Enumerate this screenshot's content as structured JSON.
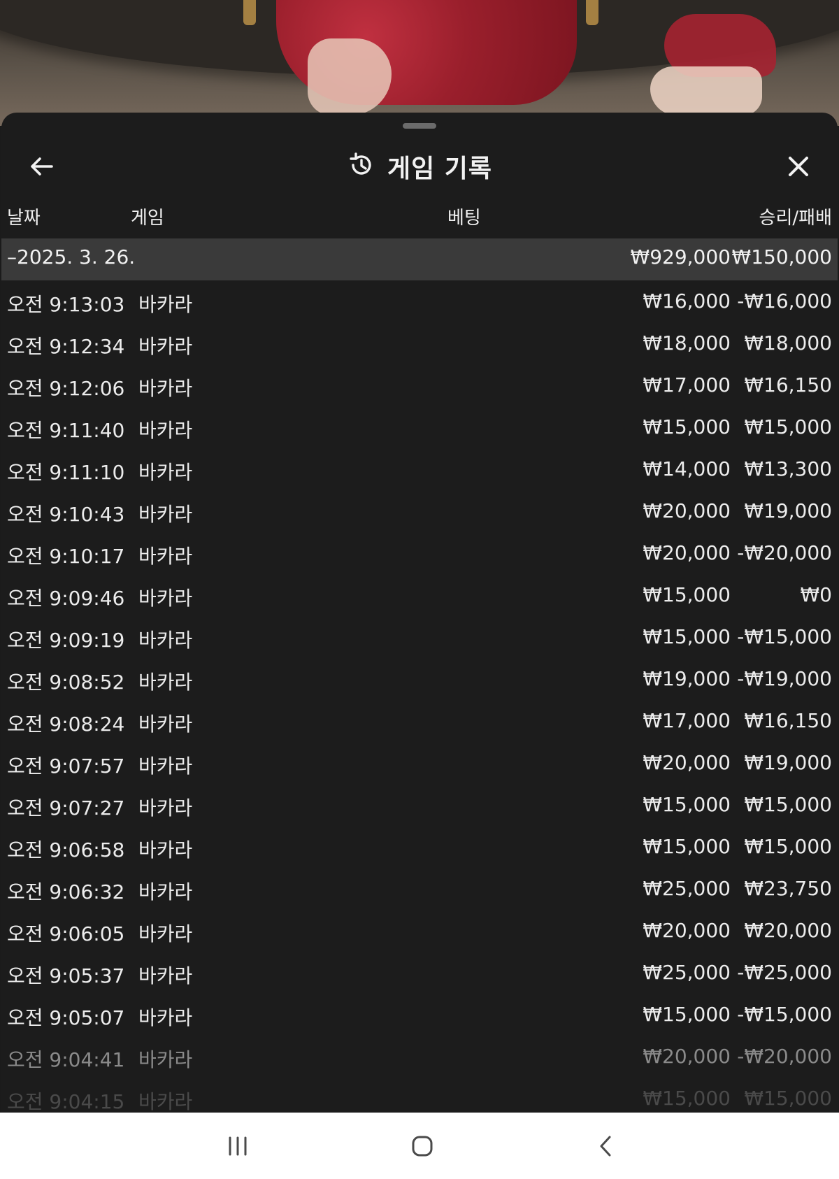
{
  "header": {
    "title": "게임 기록"
  },
  "columns": {
    "date": "날짜",
    "game": "게임",
    "bet": "베팅",
    "result": "승리/패배"
  },
  "summary": {
    "date": "–2025. 3. 26.",
    "bet_total": "₩929,000",
    "result_total": "₩150,000"
  },
  "rows": [
    {
      "time": "오전 9:13:03",
      "game": "바카라",
      "bet": "₩16,000",
      "result": "-₩16,000"
    },
    {
      "time": "오전 9:12:34",
      "game": "바카라",
      "bet": "₩18,000",
      "result": "₩18,000"
    },
    {
      "time": "오전 9:12:06",
      "game": "바카라",
      "bet": "₩17,000",
      "result": "₩16,150"
    },
    {
      "time": "오전 9:11:40",
      "game": "바카라",
      "bet": "₩15,000",
      "result": "₩15,000"
    },
    {
      "time": "오전 9:11:10",
      "game": "바카라",
      "bet": "₩14,000",
      "result": "₩13,300"
    },
    {
      "time": "오전 9:10:43",
      "game": "바카라",
      "bet": "₩20,000",
      "result": "₩19,000"
    },
    {
      "time": "오전 9:10:17",
      "game": "바카라",
      "bet": "₩20,000",
      "result": "-₩20,000"
    },
    {
      "time": "오전 9:09:46",
      "game": "바카라",
      "bet": "₩15,000",
      "result": "₩0"
    },
    {
      "time": "오전 9:09:19",
      "game": "바카라",
      "bet": "₩15,000",
      "result": "-₩15,000"
    },
    {
      "time": "오전 9:08:52",
      "game": "바카라",
      "bet": "₩19,000",
      "result": "-₩19,000"
    },
    {
      "time": "오전 9:08:24",
      "game": "바카라",
      "bet": "₩17,000",
      "result": "₩16,150"
    },
    {
      "time": "오전 9:07:57",
      "game": "바카라",
      "bet": "₩20,000",
      "result": "₩19,000"
    },
    {
      "time": "오전 9:07:27",
      "game": "바카라",
      "bet": "₩15,000",
      "result": "₩15,000"
    },
    {
      "time": "오전 9:06:58",
      "game": "바카라",
      "bet": "₩15,000",
      "result": "₩15,000"
    },
    {
      "time": "오전 9:06:32",
      "game": "바카라",
      "bet": "₩25,000",
      "result": "₩23,750"
    },
    {
      "time": "오전 9:06:05",
      "game": "바카라",
      "bet": "₩20,000",
      "result": "₩20,000"
    },
    {
      "time": "오전 9:05:37",
      "game": "바카라",
      "bet": "₩25,000",
      "result": "-₩25,000"
    },
    {
      "time": "오전 9:05:07",
      "game": "바카라",
      "bet": "₩15,000",
      "result": "-₩15,000"
    },
    {
      "time": "오전 9:04:41",
      "game": "바카라",
      "bet": "₩20,000",
      "result": "-₩20,000"
    },
    {
      "time": "오전 9:04:15",
      "game": "바카라",
      "bet": "₩15,000",
      "result": "₩15,000"
    }
  ],
  "icons": {
    "back": "arrow-left-icon",
    "history": "history-clock-icon",
    "close": "close-icon",
    "nav_recents": "recents-icon",
    "nav_home": "home-icon",
    "nav_back": "chevron-left-icon"
  },
  "colors": {
    "sheet_bg": "#1c1c1c",
    "summary_bg": "#3a3a3a",
    "text": "#ececec",
    "navbar_bg": "#ffffff"
  }
}
